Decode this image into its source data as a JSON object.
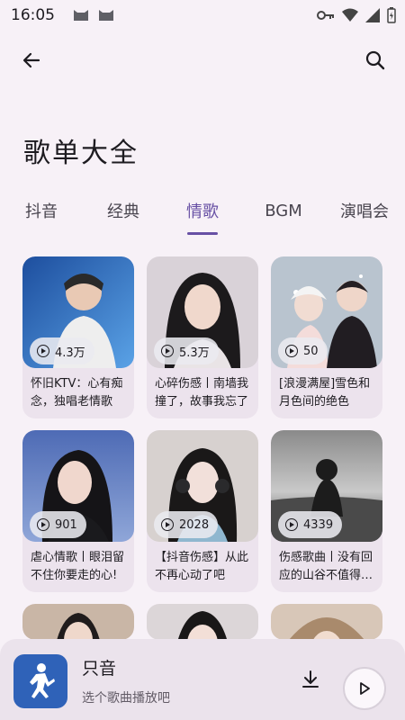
{
  "status_bar": {
    "time": "16:05"
  },
  "header": {
    "title": "歌单大全"
  },
  "tabs": [
    {
      "label": "抖音",
      "active": false
    },
    {
      "label": "经典",
      "active": false
    },
    {
      "label": "情歌",
      "active": true
    },
    {
      "label": "BGM",
      "active": false
    },
    {
      "label": "演唱会",
      "active": false
    }
  ],
  "playlists": [
    {
      "title": "怀旧KTV：心有痴念，独唱老情歌",
      "plays": "4.3万"
    },
    {
      "title": "心碎伤感丨南墙我撞了，故事我忘了",
      "plays": "5.3万"
    },
    {
      "title": "[浪漫满屋]雪色和月色间的绝色",
      "plays": "50"
    },
    {
      "title": "虐心情歌丨眼泪留不住你要走的心!",
      "plays": "901"
    },
    {
      "title": "【抖音伤感】从此不再心动了吧",
      "plays": "2028"
    },
    {
      "title": "伤感歌曲丨没有回应的山谷不值得…",
      "plays": "4339"
    }
  ],
  "player": {
    "name": "只音",
    "subtitle": "选个歌曲播放吧"
  },
  "colors": {
    "accent": "#6750a4",
    "background": "#f7f1f7",
    "player_cover": "#2f62b8"
  }
}
